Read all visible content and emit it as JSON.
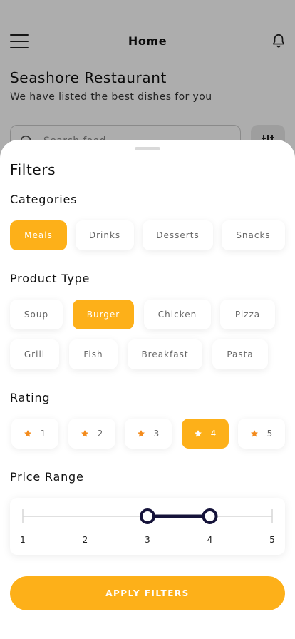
{
  "header": {
    "title": "Home"
  },
  "restaurant": {
    "name": "Seashore Restaurant",
    "tagline": "We have listed the best dishes for you"
  },
  "search": {
    "placeholder": "Search food..."
  },
  "filters": {
    "title": "Filters",
    "categories": {
      "label": "Categories",
      "items": [
        "Meals",
        "Drinks",
        "Desserts",
        "Snacks"
      ],
      "selected": "Meals"
    },
    "product_type": {
      "label": "Product Type",
      "items": [
        "Soup",
        "Burger",
        "Chicken",
        "Pizza",
        "Grill",
        "Fish",
        "Breakfast",
        "Pasta"
      ],
      "selected": "Burger"
    },
    "rating": {
      "label": "Rating",
      "items": [
        "1",
        "2",
        "3",
        "4",
        "5"
      ],
      "selected": "4",
      "icon": "star-icon"
    },
    "price_range": {
      "label": "Price Range",
      "ticks": [
        "1",
        "2",
        "3",
        "4",
        "5"
      ],
      "min": 1,
      "max": 5,
      "selected_low": 3,
      "selected_high": 4
    },
    "apply_label": "APPLY FILTERS"
  },
  "colors": {
    "accent": "#fdb019",
    "star": "#f38b1c",
    "slider_active": "#15133a",
    "slider_track": "#d6d6d6"
  }
}
